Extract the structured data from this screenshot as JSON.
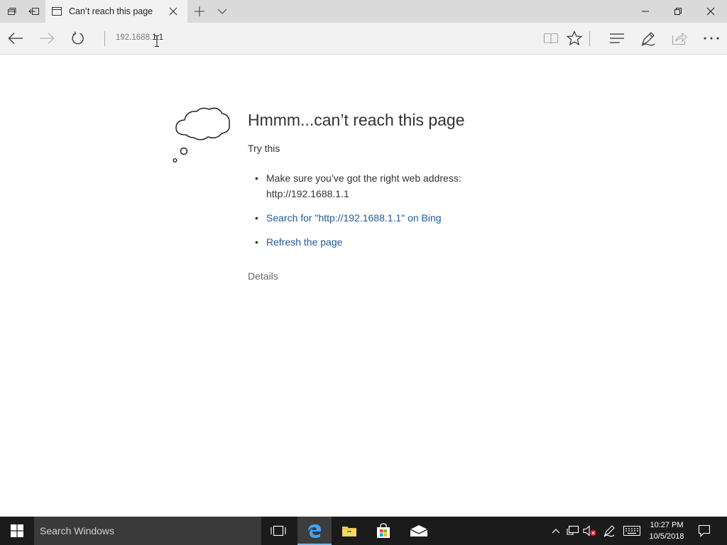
{
  "tab": {
    "title": "Can’t reach this page"
  },
  "address_bar": {
    "url_before_cursor": "192.1688.",
    "url_after_cursor": "1.1"
  },
  "error_page": {
    "heading": "Hmmm...can’t reach this page",
    "try_this": "Try this",
    "suggestion_1_line1": "Make sure you’ve got the right web address:",
    "suggestion_1_line2": "http://192.1688.1.1",
    "suggestion_2_link": "Search for \"http://192.1688.1.1\" on Bing",
    "suggestion_3_link": "Refresh the page",
    "details": "Details"
  },
  "taskbar": {
    "search_placeholder": "Search Windows",
    "clock_time": "10:27 PM",
    "clock_date": "10/5/2018"
  },
  "colors": {
    "tab_bar": "#dadada",
    "toolbar": "#f2f2f2",
    "link": "#1f5a99",
    "taskbar": "#1b1b1b",
    "edge_blue": "#1e73cf"
  },
  "icons": [
    "tab-list-icon",
    "set-aside-tabs-icon",
    "tab-favicon-icon",
    "close-tab-icon",
    "new-tab-icon",
    "tab-preview-chevron-icon",
    "minimize-icon",
    "restore-icon",
    "close-window-icon",
    "back-icon",
    "forward-icon",
    "refresh-icon",
    "reading-view-icon",
    "favorite-star-icon",
    "hub-icon",
    "web-note-icon",
    "share-icon",
    "more-icon",
    "windows-logo-icon",
    "task-view-icon",
    "edge-icon",
    "file-explorer-icon",
    "store-icon",
    "mail-icon",
    "chevron-up-icon",
    "network-icon",
    "volume-muted-icon",
    "pen-icon",
    "keyboard-icon",
    "action-center-icon"
  ]
}
